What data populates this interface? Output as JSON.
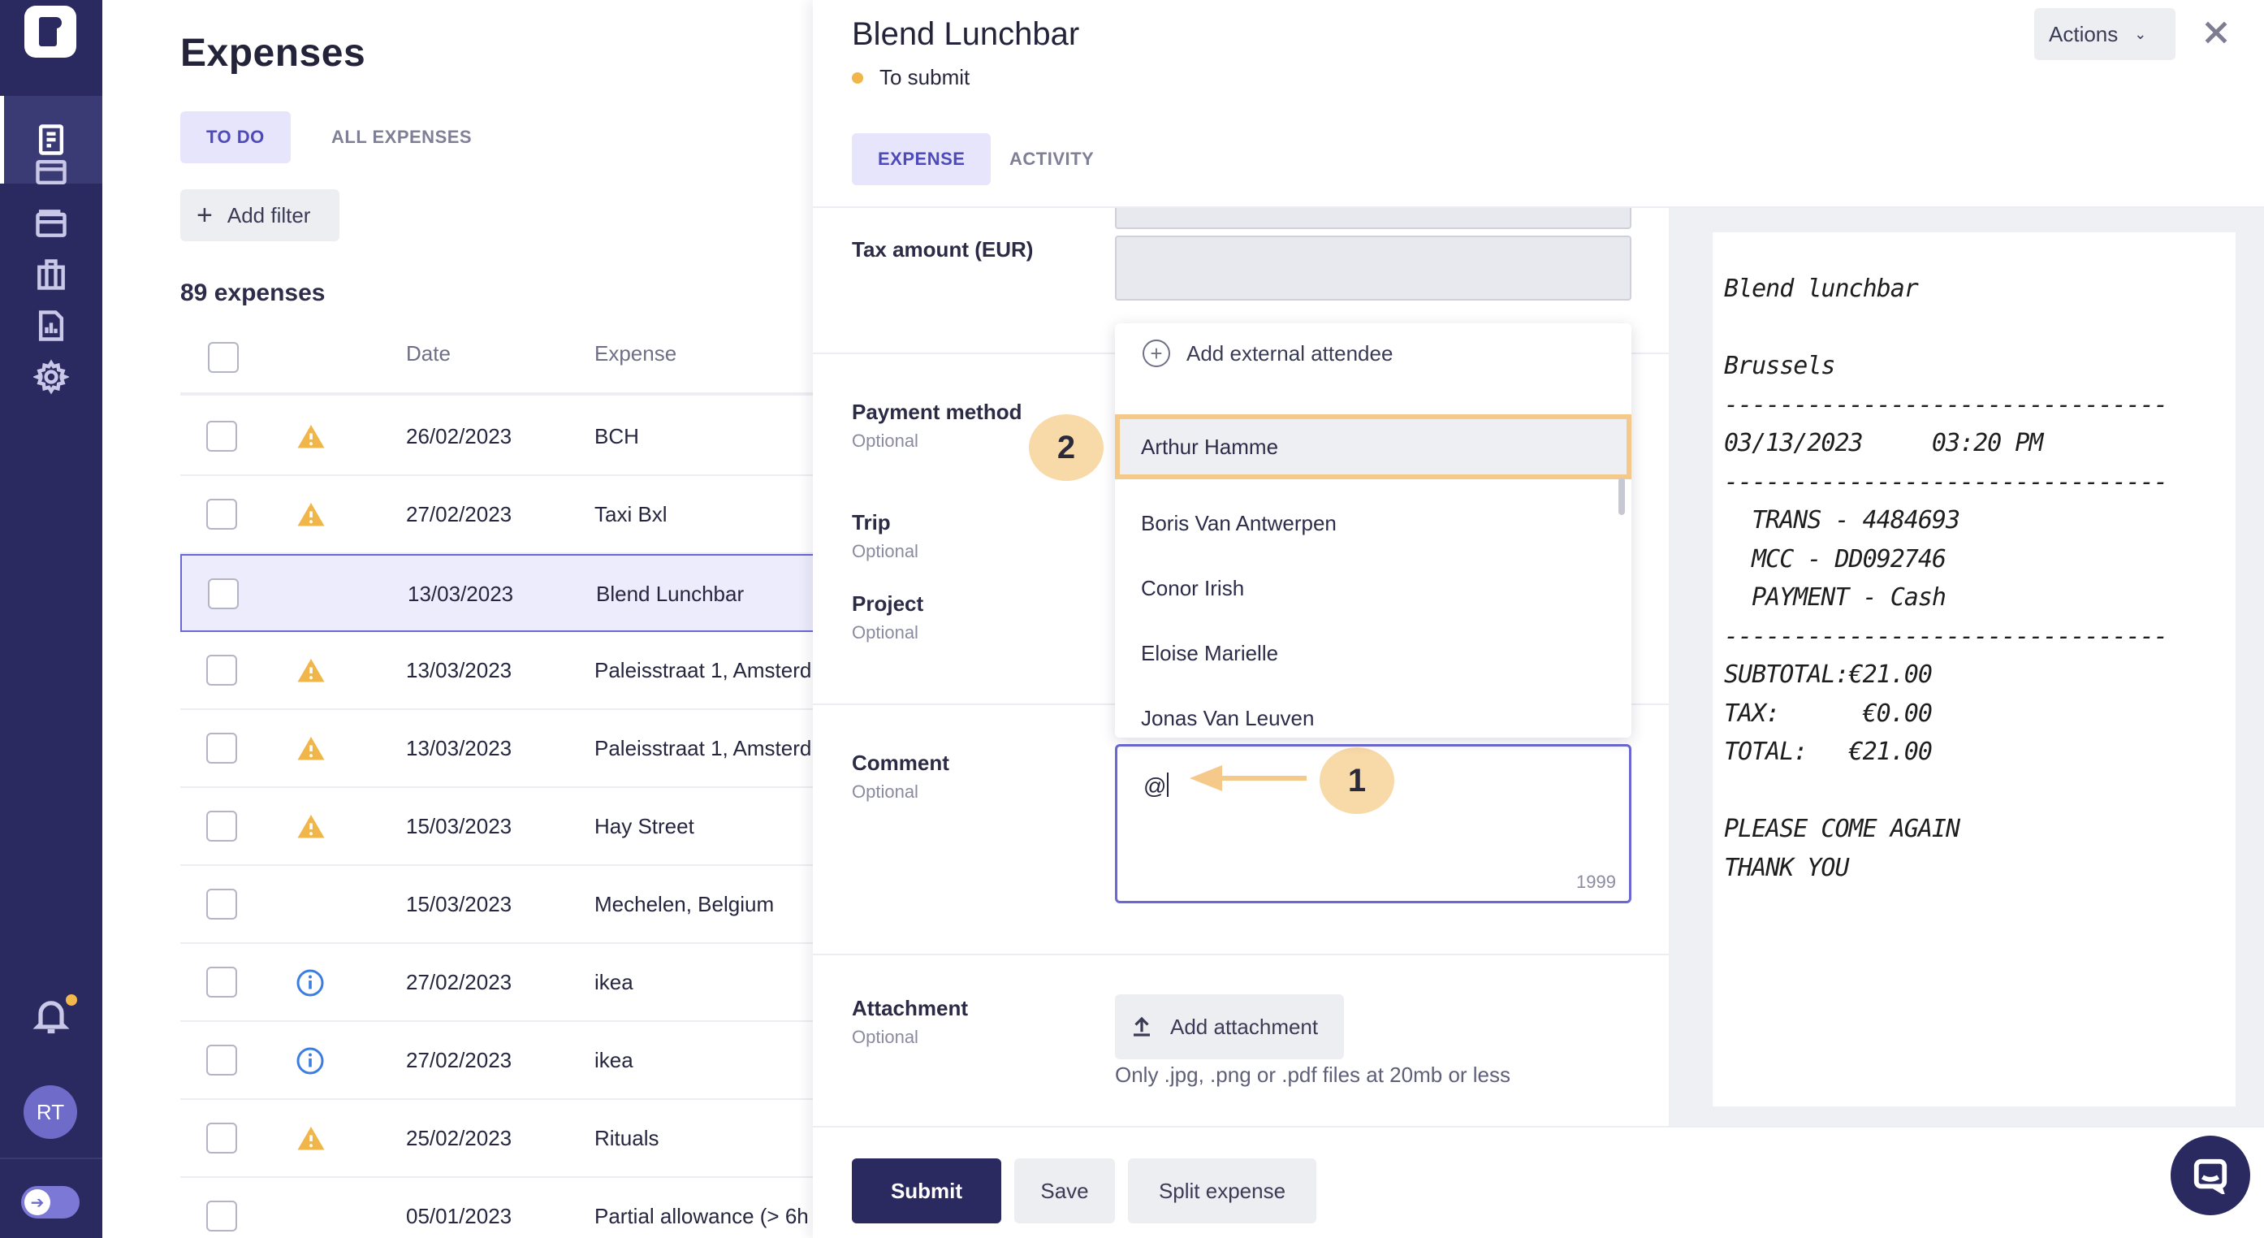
{
  "sidebar": {
    "logo": "r-logo",
    "nav": [
      {
        "name": "home",
        "icon": "home-icon",
        "active": false
      },
      {
        "name": "expenses",
        "icon": "receipt-icon",
        "active": true
      },
      {
        "name": "cards",
        "icon": "card-icon",
        "active": false
      },
      {
        "name": "wallet",
        "icon": "wallet-icon",
        "active": false
      },
      {
        "name": "company",
        "icon": "building-icon",
        "active": false
      },
      {
        "name": "reports",
        "icon": "report-icon",
        "active": false
      },
      {
        "name": "settings",
        "icon": "gear-icon",
        "active": false
      }
    ],
    "avatar_initials": "RT",
    "notification_color": "#f3b84b"
  },
  "list": {
    "title": "Expenses",
    "tabs": [
      "TO DO",
      "ALL EXPENSES"
    ],
    "add_filter_label": "Add filter",
    "count_label": "89 expenses",
    "columns": [
      "Date",
      "Expense"
    ],
    "rows": [
      {
        "date": "26/02/2023",
        "name": "BCH",
        "status_icon": "warning-icon",
        "selected": false
      },
      {
        "date": "27/02/2023",
        "name": "Taxi Bxl",
        "status_icon": "warning-icon",
        "selected": false
      },
      {
        "date": "13/03/2023",
        "name": "Blend Lunchbar",
        "status_icon": "",
        "selected": true
      },
      {
        "date": "13/03/2023",
        "name": "Paleisstraat 1, Amsterd",
        "status_icon": "warning-icon",
        "selected": false
      },
      {
        "date": "13/03/2023",
        "name": "Paleisstraat 1, Amsterd",
        "status_icon": "warning-icon",
        "selected": false
      },
      {
        "date": "15/03/2023",
        "name": "Hay Street",
        "status_icon": "warning-icon",
        "selected": false
      },
      {
        "date": "15/03/2023",
        "name": "Mechelen, Belgium",
        "status_icon": "",
        "selected": false
      },
      {
        "date": "27/02/2023",
        "name": "ikea",
        "status_icon": "info-icon",
        "selected": false
      },
      {
        "date": "27/02/2023",
        "name": "ikea",
        "status_icon": "info-icon",
        "selected": false
      },
      {
        "date": "25/02/2023",
        "name": "Rituals",
        "status_icon": "warning-icon",
        "selected": false
      },
      {
        "date": "05/01/2023",
        "name": "Partial allowance (> 6h",
        "status_icon": "",
        "selected": false
      }
    ]
  },
  "panel": {
    "title": "Blend Lunchbar",
    "status": "To submit",
    "status_color": "#f1b64a",
    "actions_label": "Actions",
    "tabs": [
      "EXPENSE",
      "ACTIVITY"
    ],
    "fields": {
      "tax_amount_label": "Tax amount (EUR)",
      "payment_method_label": "Payment method",
      "trip_label": "Trip",
      "project_label": "Project",
      "comment_label": "Comment",
      "attachment_label": "Attachment",
      "optional": "Optional"
    },
    "attendee_dropdown": {
      "add_external": "Add external attendee",
      "options": [
        "Arthur Hamme",
        "Boris Van Antwerpen",
        "Conor Irish",
        "Eloise Marielle",
        "Jonas Van Leuven"
      ],
      "highlighted": "Arthur Hamme"
    },
    "comment": {
      "value": "@",
      "char_count": "1999"
    },
    "attachment": {
      "button_label": "Add attachment",
      "hint": "Only .jpg, .png or .pdf files at 20mb or less"
    },
    "annotations": [
      "1",
      "2"
    ],
    "footer": {
      "submit": "Submit",
      "save": "Save",
      "split": "Split expense"
    }
  },
  "receipt": {
    "lines": "Blend lunchbar\n\nBrussels\n--------------------------------\n03/13/2023     03:20 PM\n--------------------------------\n  TRANS - 4484693\n  MCC - DD092746\n  PAYMENT - Cash\n--------------------------------\nSUBTOTAL:€21.00\nTAX:      €0.00\nTOTAL:   €21.00\n\nPLEASE COME AGAIN\nTHANK YOU"
  },
  "colors": {
    "sidebar": "#2b2a60",
    "accent": "#6c68d3",
    "warning": "#f1b64a",
    "info": "#3b7ee0",
    "annotation": "#f8d9a8"
  }
}
